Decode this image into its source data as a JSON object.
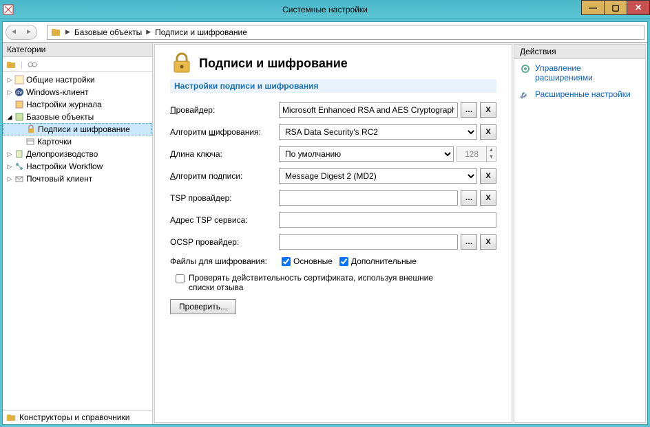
{
  "window": {
    "title": "Системные настройки"
  },
  "breadcrumb": {
    "item1": "Базовые объекты",
    "item2": "Подписи и шифрование"
  },
  "sidebar": {
    "header": "Категории",
    "footer": "Конструкторы и справочники",
    "items": {
      "general": "Общие настройки",
      "windows": "Windows-клиент",
      "journal": "Настройки журнала",
      "base": "Базовые объекты",
      "sign": "Подписи и шифрование",
      "cards": "Карточки",
      "records": "Делопроизводство",
      "workflow": "Настройки Workflow",
      "mail": "Почтовый клиент"
    }
  },
  "main": {
    "heading": "Подписи и шифрование",
    "section": "Настройки подписи и шифрования",
    "labels": {
      "provider": "Провайдер:",
      "enc_alg": "Алгоритм шифрования:",
      "key_len": "Длина ключа:",
      "sign_alg": "Алгоритм подписи:",
      "tsp_provider": "TSP провайдер:",
      "tsp_addr": "Адрес TSP сервиса:",
      "ocsp_provider": "OCSP провайдер:",
      "files_for_enc": "Файлы для шифрования:",
      "cb_main": "Основные",
      "cb_extra": "Дополнительные",
      "check_cert": "Проверять действительность сертификата, используя внешние списки отзыва",
      "verify_btn": "Проверить..."
    },
    "values": {
      "provider": "Microsoft Enhanced RSA and AES Cryptographic Prov",
      "enc_alg": "RSA Data Security's RC2",
      "key_len": "По умолчанию",
      "key_len_num": "128",
      "sign_alg": "Message Digest 2 (MD2)",
      "tsp_provider": "",
      "tsp_addr": "",
      "ocsp_provider": ""
    }
  },
  "actions": {
    "header": "Действия",
    "link1": "Управление расширениями",
    "link2": "Расширенные настройки"
  }
}
